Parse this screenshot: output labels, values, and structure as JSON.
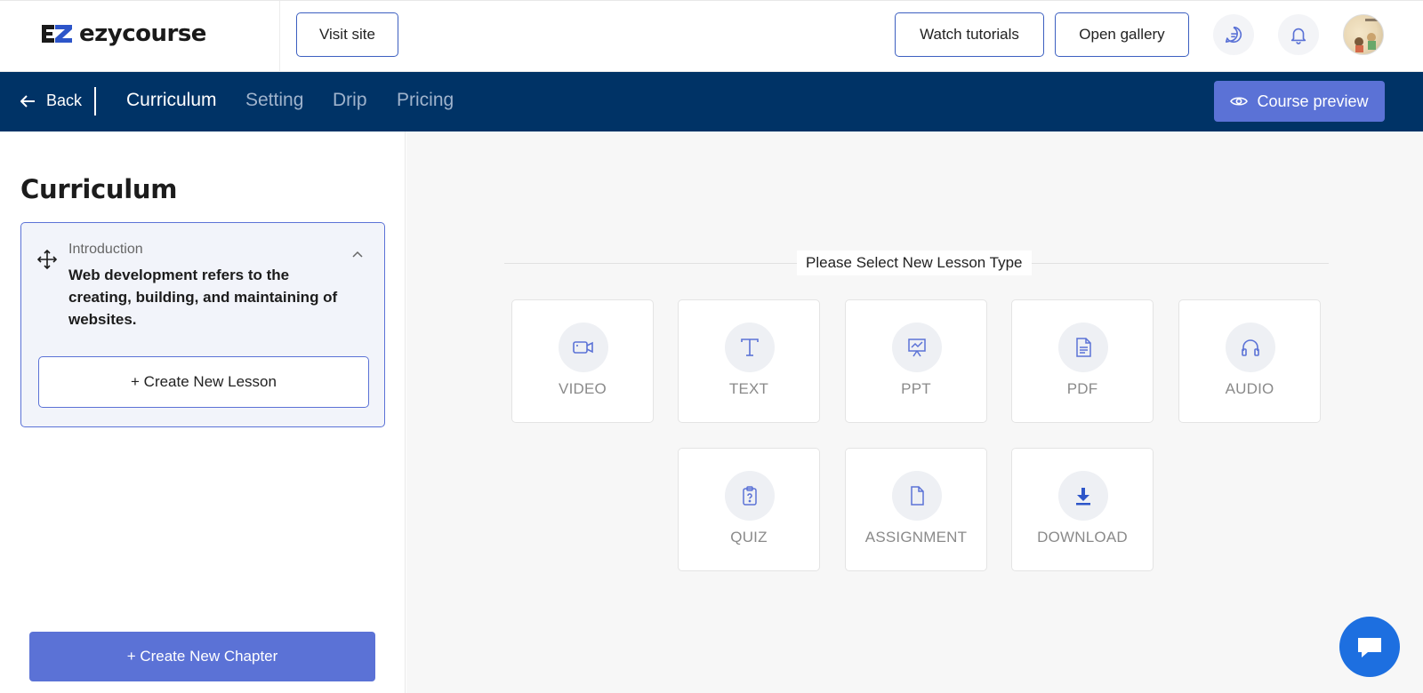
{
  "header": {
    "logo_text": "ezycourse",
    "visit_site": "Visit site",
    "watch_tutorials": "Watch tutorials",
    "open_gallery": "Open gallery"
  },
  "nav": {
    "back": "Back",
    "tabs": [
      {
        "label": "Curriculum",
        "active": true
      },
      {
        "label": "Setting",
        "active": false
      },
      {
        "label": "Drip",
        "active": false
      },
      {
        "label": "Pricing",
        "active": false
      }
    ],
    "course_preview": "Course preview"
  },
  "sidebar": {
    "title": "Curriculum",
    "chapter": {
      "label": "Introduction",
      "description": "Web development refers to the creating, building, and maintaining of websites."
    },
    "create_lesson": "+ Create New Lesson",
    "create_chapter": "+ Create New Chapter"
  },
  "main": {
    "select_title": "Please Select New Lesson Type",
    "lesson_types": [
      {
        "label": "VIDEO",
        "icon": "video-icon"
      },
      {
        "label": "TEXT",
        "icon": "text-icon"
      },
      {
        "label": "PPT",
        "icon": "presentation-icon"
      },
      {
        "label": "PDF",
        "icon": "document-icon"
      },
      {
        "label": "AUDIO",
        "icon": "headphones-icon"
      },
      {
        "label": "QUIZ",
        "icon": "clipboard-question-icon"
      },
      {
        "label": "ASSIGNMENT",
        "icon": "file-icon"
      },
      {
        "label": "DOWNLOAD",
        "icon": "download-icon"
      }
    ]
  },
  "colors": {
    "navy": "#003366",
    "accent": "#5b72d6",
    "chat": "#1d6fe0"
  }
}
